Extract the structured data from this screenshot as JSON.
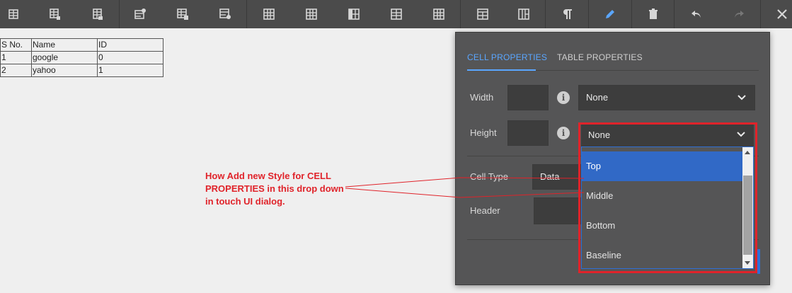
{
  "toolbar": {
    "icons": [
      "insert-row-above-icon",
      "insert-row-below-icon",
      "delete-row-icon",
      "table-settings-icon",
      "table-add-icon",
      "table-remove-icon",
      "column-left-icon",
      "column-right-icon",
      "column-delete-icon",
      "merge-cells-icon",
      "split-cells-icon",
      "merge-right-icon",
      "merge-down-icon",
      "paragraph-icon",
      "pencil-icon",
      "trash-icon",
      "undo-icon",
      "redo-icon",
      "close-icon"
    ]
  },
  "table": {
    "headers": [
      "S No.",
      "Name",
      "ID"
    ],
    "rows": [
      [
        "1",
        "google",
        "0"
      ],
      [
        "2",
        "yahoo",
        "1"
      ]
    ]
  },
  "annotation": {
    "text": "How Add new Style for CELL PROPERTIES in this drop down in touch UI dialog.",
    "color": "#e0232a"
  },
  "dialog": {
    "tabs": [
      "CELL PROPERTIES",
      "TABLE PROPERTIES"
    ],
    "active_tab": "CELL PROPERTIES",
    "width_label": "Width",
    "width_select": "None",
    "height_label": "Height",
    "height_select": "None",
    "cell_type_label": "Cell Type",
    "cell_type_value": "Data",
    "header_label": "Header",
    "dropdown_options": [
      "Top",
      "Middle",
      "Bottom",
      "Baseline"
    ],
    "dropdown_selected": "Top"
  },
  "colors": {
    "toolbar_bg": "#4b4b4b",
    "dialog_bg": "#555556",
    "accent": "#5aa6ff",
    "highlight": "#e0232a",
    "selected_option": "#3169c6"
  }
}
